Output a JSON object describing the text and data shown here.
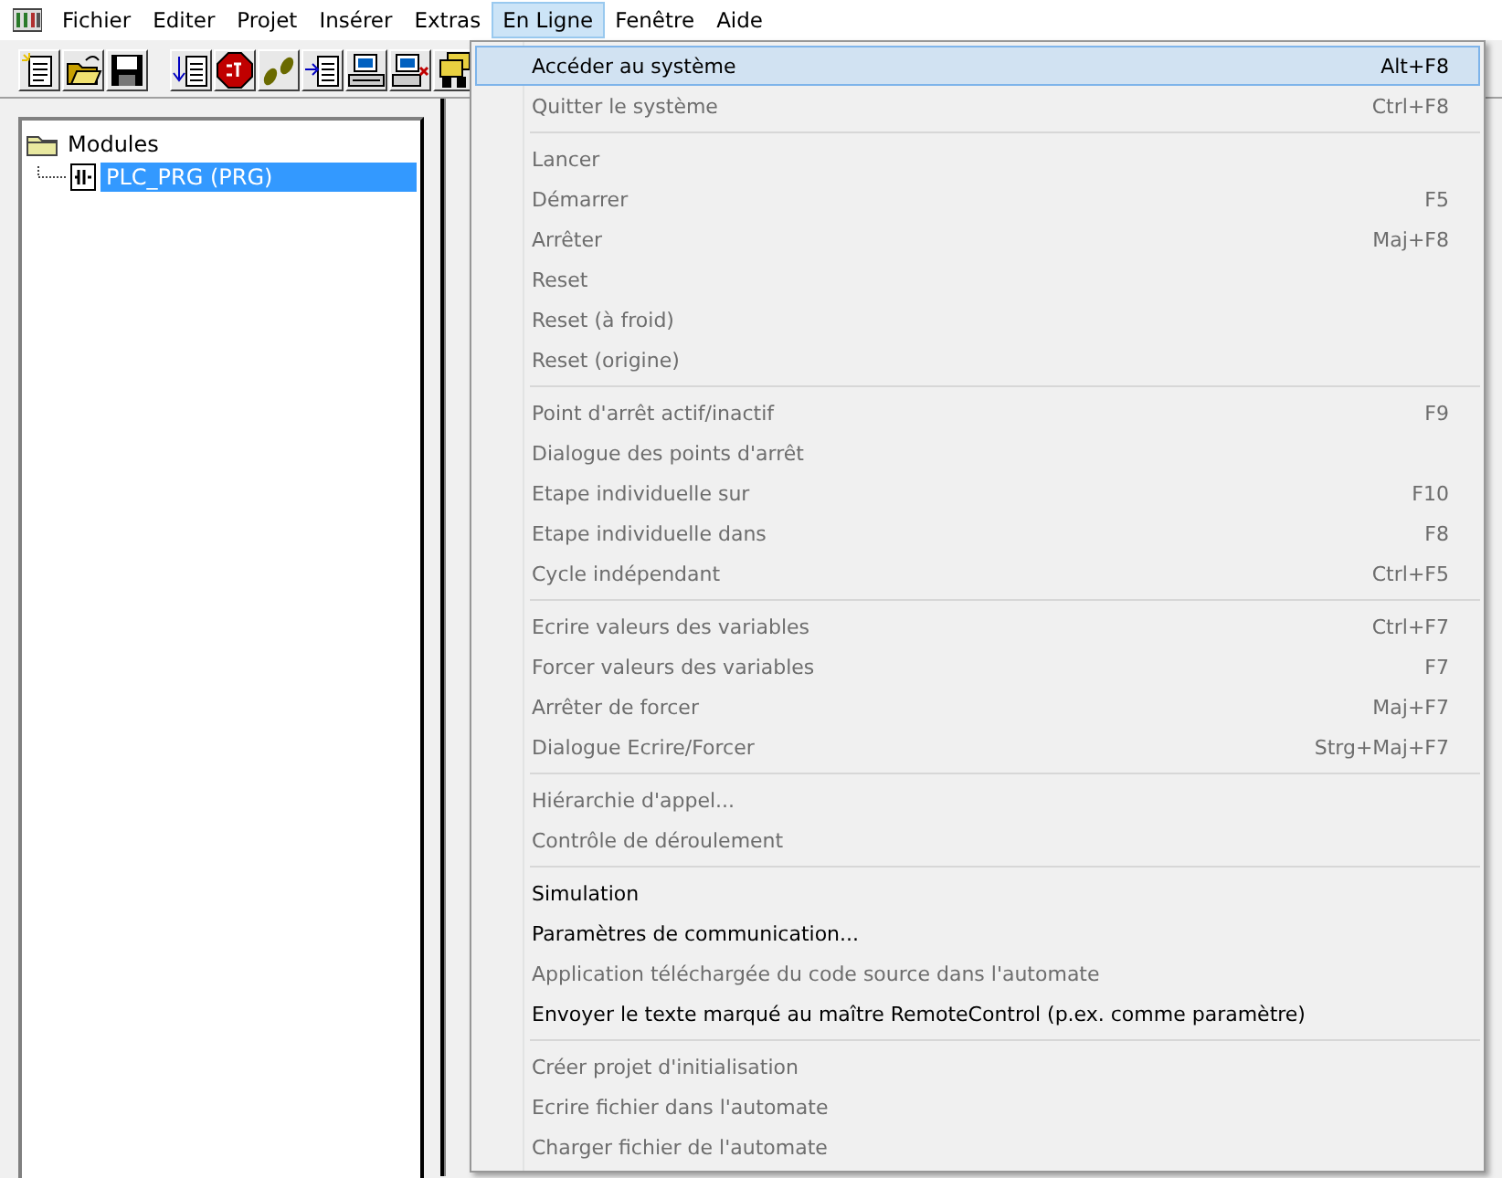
{
  "menubar": [
    {
      "label": "Fichier",
      "selected": false
    },
    {
      "label": "Editer",
      "selected": false
    },
    {
      "label": "Projet",
      "selected": false
    },
    {
      "label": "Insérer",
      "selected": false
    },
    {
      "label": "Extras",
      "selected": false
    },
    {
      "label": "En Ligne",
      "selected": true
    },
    {
      "label": "Fenêtre",
      "selected": false
    },
    {
      "label": "Aide",
      "selected": false
    }
  ],
  "tree": {
    "label": "Modules",
    "expanded": true,
    "children": [
      {
        "label": "PLC_PRG (PRG)",
        "selected": true
      }
    ]
  },
  "menu": {
    "groups": [
      [
        {
          "label": "Accéder au système",
          "shortcut": "Alt+F8",
          "disabled": false,
          "selected": true
        },
        {
          "label": "Quitter le système",
          "shortcut": "Ctrl+F8",
          "disabled": true,
          "selected": false
        }
      ],
      [
        {
          "label": "Lancer",
          "disabled": true,
          "selected": false
        },
        {
          "label": "Démarrer",
          "shortcut": "F5",
          "disabled": true,
          "selected": false
        },
        {
          "label": "Arrêter",
          "shortcut": "Maj+F8",
          "disabled": true,
          "selected": false
        },
        {
          "label": "Reset",
          "disabled": true,
          "selected": false
        },
        {
          "label": "Reset (à froid)",
          "disabled": true,
          "selected": false
        },
        {
          "label": "Reset (origine)",
          "disabled": true,
          "selected": false
        }
      ],
      [
        {
          "label": "Point d'arrêt actif/inactif",
          "shortcut": "F9",
          "disabled": true,
          "selected": false
        },
        {
          "label": "Dialogue des points d'arrêt",
          "disabled": true,
          "selected": false
        },
        {
          "label": "Etape individuelle sur",
          "shortcut": "F10",
          "disabled": true,
          "selected": false
        },
        {
          "label": "Etape individuelle dans",
          "shortcut": "F8",
          "disabled": true,
          "selected": false
        },
        {
          "label": "Cycle indépendant",
          "shortcut": "Ctrl+F5",
          "disabled": true,
          "selected": false
        }
      ],
      [
        {
          "label": "Ecrire valeurs des variables",
          "shortcut": "Ctrl+F7",
          "disabled": true,
          "selected": false
        },
        {
          "label": "Forcer valeurs des variables",
          "shortcut": "F7",
          "disabled": true,
          "selected": false
        },
        {
          "label": "Arrêter de forcer",
          "shortcut": "Maj+F7",
          "disabled": true,
          "selected": false
        },
        {
          "label": "Dialogue Ecrire/Forcer",
          "shortcut": "Strg+Maj+F7",
          "disabled": true,
          "selected": false
        }
      ],
      [
        {
          "label": "Hiérarchie d'appel...",
          "disabled": true,
          "selected": false
        },
        {
          "label": "Contrôle de déroulement",
          "disabled": true,
          "selected": false
        }
      ],
      [
        {
          "label": "Simulation",
          "disabled": false,
          "selected": false
        },
        {
          "label": "Paramètres de communication...",
          "disabled": false,
          "selected": false
        },
        {
          "label": "Application téléchargée du code source dans l'automate",
          "disabled": true,
          "selected": false
        },
        {
          "label": "Envoyer le texte marqué au maître RemoteControl  (p.ex. comme paramètre)",
          "disabled": false,
          "selected": false
        }
      ],
      [
        {
          "label": "Créer projet d'initialisation",
          "disabled": true,
          "selected": false
        },
        {
          "label": "Ecrire fichier dans l'automate",
          "disabled": true,
          "selected": false
        },
        {
          "label": "Charger fichier de l'automate",
          "disabled": true,
          "selected": false
        }
      ]
    ]
  }
}
